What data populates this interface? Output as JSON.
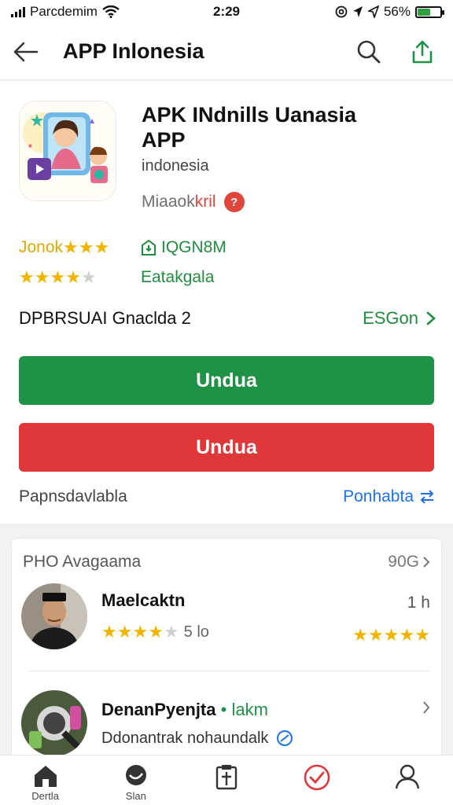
{
  "status_bar": {
    "carrier": "Parcdemim",
    "time": "2:29",
    "battery": "56%",
    "battery_level": 0.56
  },
  "app_bar": {
    "title": "APP Inlonesia",
    "back_icon": "arrow-left-icon",
    "search_icon": "search-icon",
    "share_icon": "share-icon"
  },
  "app": {
    "name_line1": "APK INdnills Uanasia",
    "name_line2": "APP",
    "subtitle": "indonesia",
    "developer_prefix": "Miaaok",
    "developer_suffix": "kril",
    "info_badge": "?"
  },
  "stats": {
    "rating_label": "Jonok",
    "rating_label_stars": 3,
    "rating_stars": 4,
    "size": "IQGN8M",
    "category": "Eatakgala"
  },
  "version": {
    "label": "DPBRSUAI Gnaclda 2",
    "link": "ESGon"
  },
  "buttons": {
    "primary": "Undua",
    "secondary": "Undua"
  },
  "permissions": {
    "label": "Papnsdavlabla",
    "link": "Ponhabta"
  },
  "reviews": {
    "title": "PHO Avagaama",
    "count": "90G",
    "items": [
      {
        "name": "Maelcaktn",
        "time": "1 h",
        "stars": 4,
        "stars_value": "5 lo",
        "right_stars": 5
      },
      {
        "name": "DenanPyenjta",
        "name_accent": "• lakm",
        "text": "Ddonantrak nohaundalk"
      }
    ]
  },
  "bottom_nav": [
    {
      "label": "Dertla",
      "icon": "home-icon"
    },
    {
      "label": "Slan",
      "icon": "chat-icon"
    },
    {
      "label": "",
      "icon": "clipboard-icon"
    },
    {
      "label": "",
      "icon": "check-circle-icon"
    },
    {
      "label": "",
      "icon": "profile-icon"
    }
  ],
  "colors": {
    "green": "#1e9245",
    "red": "#e0383a",
    "star": "#f2b400",
    "link_blue": "#1a73e8"
  }
}
